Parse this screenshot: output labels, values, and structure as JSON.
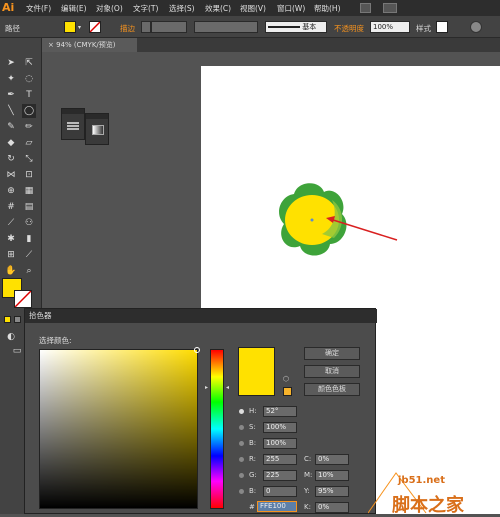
{
  "app": {
    "logo": "Ai"
  },
  "menu": [
    "文件(F)",
    "编辑(E)",
    "对象(O)",
    "文字(T)",
    "选择(S)",
    "效果(C)",
    "视图(V)",
    "窗口(W)",
    "帮助(H)"
  ],
  "control_bar": {
    "label_path": "路径",
    "stroke_label": "描边",
    "style_value": "基本",
    "opacity_label": "不透明度",
    "opacity_value": "100%",
    "style_label": "样式"
  },
  "document_tab": {
    "label": "94% (CMYK/预览)"
  },
  "colors": {
    "fill": "#ffe100",
    "artwork_green": "#3ea33a",
    "artwork_yellow": "#ffe100",
    "arrow": "#d92020"
  },
  "color_picker": {
    "title": "拾色器",
    "prompt": "选择颜色:",
    "buttons": {
      "ok": "确定",
      "cancel": "取消",
      "swatches": "颜色色板"
    },
    "fields": {
      "H": {
        "label": "H:",
        "value": "52°"
      },
      "S": {
        "label": "S:",
        "value": "100%"
      },
      "B": {
        "label": "B:",
        "value": "100%"
      },
      "R": {
        "label": "R:",
        "value": "255"
      },
      "G": {
        "label": "G:",
        "value": "225"
      },
      "Bb": {
        "label": "B:",
        "value": "0"
      },
      "C": {
        "label": "C:",
        "value": "0%"
      },
      "M": {
        "label": "M:",
        "value": "10%"
      },
      "Y": {
        "label": "Y:",
        "value": "95%"
      },
      "K": {
        "label": "K:",
        "value": "0%"
      },
      "hex_label": "#",
      "hex": "FFE100"
    }
  },
  "watermark": {
    "site": "jb51.net",
    "text": "脚本之家"
  }
}
